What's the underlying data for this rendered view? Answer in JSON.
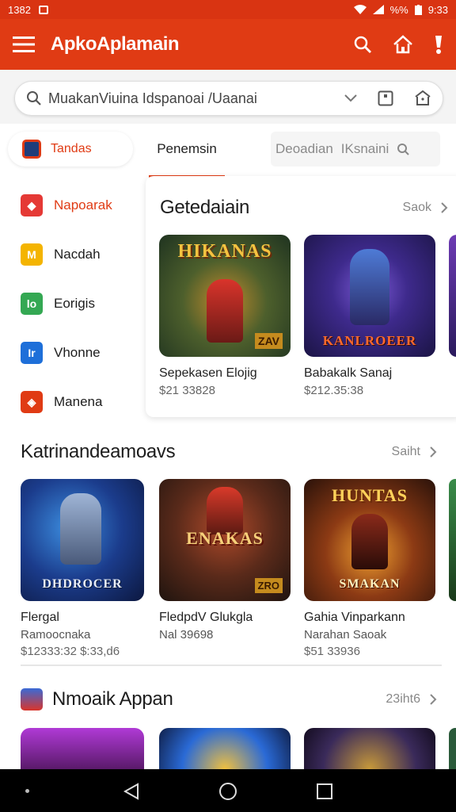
{
  "status_bar": {
    "time_left": "1382",
    "battery_text": "%%",
    "time_right": "9:33"
  },
  "app_bar": {
    "title": "ApkoAplamain"
  },
  "search": {
    "value": "MuakanViuina Idspanoai /Uaanai"
  },
  "tabs": {
    "category_label": "Tandas",
    "active_label": "Penemsin",
    "muted_label": "Deoadian",
    "muted_label_2": "IKsnaini"
  },
  "sidebar": {
    "items": [
      {
        "label": "Napoarak",
        "color": "#e53935",
        "glyph": "◆"
      },
      {
        "label": "Nacdah",
        "color": "#f4b400",
        "glyph": "M"
      },
      {
        "label": "Eorigis",
        "color": "#34a853",
        "glyph": "lo"
      },
      {
        "label": "Vhonne",
        "color": "#1e6fd9",
        "glyph": "Ir"
      },
      {
        "label": "Manena",
        "color": "#e03b14",
        "glyph": "◈"
      }
    ]
  },
  "featured": {
    "title": "Getedaiain",
    "more": "Saok",
    "cards": [
      {
        "name": "Sepekasen Elojig",
        "price": "$21 33828",
        "banner": "HIKANAS",
        "badge": "ZAV"
      },
      {
        "name": "Babakalk Sanaj",
        "price": "$212.35:38",
        "banner": "KANLROEER",
        "badge": ""
      }
    ]
  },
  "section2": {
    "title": "Katrinandeamoavs",
    "more": "Saiht",
    "cards": [
      {
        "name": "Flergal",
        "sub": "Ramoocnaka",
        "price": "$12333:32   $:33,d6",
        "banner": "DHDROCER"
      },
      {
        "name": "FledpdV Glukgla",
        "sub": "Nal 39698",
        "price": "",
        "banner": "ENAKAS",
        "badge": "ZRO"
      },
      {
        "name": "Gahia Vinparkann",
        "sub": "Narahan Saoak",
        "price": "$51 33936",
        "banner": "SMAKAN",
        "top": "HUNTAS"
      }
    ]
  },
  "section3": {
    "title": "Nmoaik Appan",
    "more": "23iht6"
  },
  "colors": {
    "accent": "#e03b14",
    "statusbar": "#d93412"
  }
}
